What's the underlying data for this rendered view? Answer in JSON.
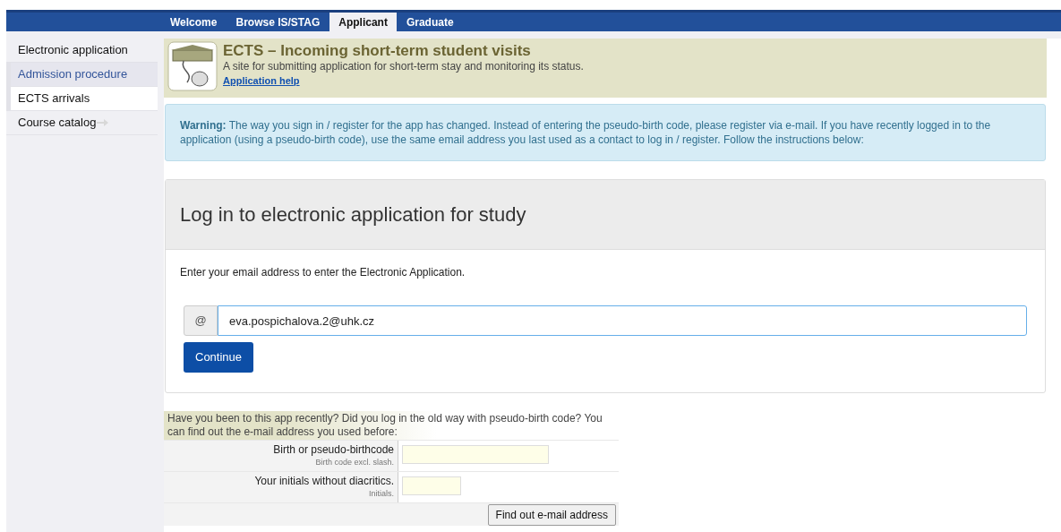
{
  "top_tabs": [
    {
      "label": "Welcome",
      "selected": false
    },
    {
      "label": "Browse IS/STAG",
      "selected": false
    },
    {
      "label": "Applicant",
      "selected": true
    },
    {
      "label": "Graduate",
      "selected": false
    }
  ],
  "sidebar": {
    "items": [
      {
        "label": "Electronic application",
        "kind": "plain",
        "selected": false
      },
      {
        "label": "Admission procedure",
        "kind": "section",
        "selected": false
      },
      {
        "label": "ECTS arrivals",
        "kind": "plain",
        "selected": true
      },
      {
        "label": "Course catalog",
        "kind": "external",
        "selected": false
      }
    ]
  },
  "header": {
    "title": "ECTS – Incoming short-term student visits",
    "subtitle": "A site for submitting application for short-term stay and monitoring its status.",
    "help_link": "Application help"
  },
  "warning": {
    "text": "**Warning:** The way you sign in / register for the app has changed. Instead of entering the pseudo-birth code, please register via e-mail. If you have recently logged in to the application (using a pseudo-birth code), use the same email address you last used as a contact to log in / register. Follow the instructions below:"
  },
  "login": {
    "title": "Log in to electronic application for study",
    "instruction": "Enter your email address to enter the Electronic Application.",
    "addon": "@",
    "email_value": "eva.pospichalova.2@uhk.cz",
    "button": "Continue"
  },
  "recovery": {
    "intro": "Have you been to this app recently? Did you log in the old way with pseudo-birth code? You can find out the e-mail address you used before:",
    "fields": [
      {
        "label": "Birth or pseudo-birthcode",
        "hint": "Birth code excl. slash.",
        "kind": "wide"
      },
      {
        "label": "Your initials without diacritics.",
        "hint": "Initials.",
        "kind": "narrow"
      }
    ],
    "button": "Find out e-mail address"
  }
}
